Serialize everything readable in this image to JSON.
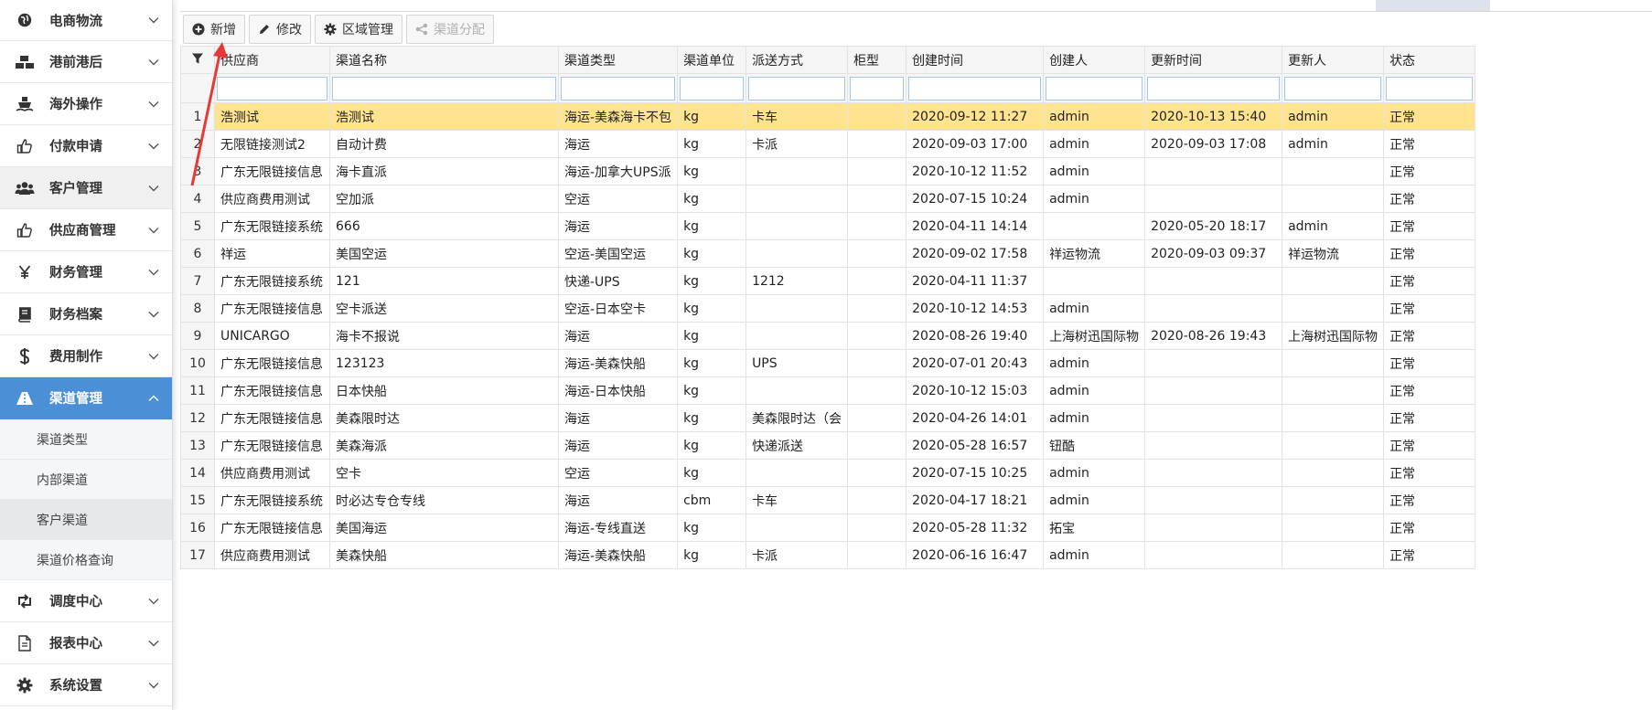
{
  "sidebar": {
    "items": [
      {
        "label": "电商物流",
        "icon": "globe-icon"
      },
      {
        "label": "港前港后",
        "icon": "cubes-icon"
      },
      {
        "label": "海外操作",
        "icon": "ship-icon"
      },
      {
        "label": "付款申请",
        "icon": "thumbs-up-icon"
      },
      {
        "label": "客户管理",
        "icon": "users-icon"
      },
      {
        "label": "供应商管理",
        "icon": "thumbs-up-icon"
      },
      {
        "label": "财务管理",
        "icon": "yen-icon"
      },
      {
        "label": "财务档案",
        "icon": "book-icon"
      },
      {
        "label": "费用制作",
        "icon": "dollar-icon"
      },
      {
        "label": "渠道管理",
        "icon": "road-icon"
      },
      {
        "label": "调度中心",
        "icon": "retweet-icon"
      },
      {
        "label": "报表中心",
        "icon": "file-icon"
      },
      {
        "label": "系统设置",
        "icon": "gear-icon"
      }
    ],
    "submenu": [
      "渠道类型",
      "内部渠道",
      "客户渠道",
      "渠道价格查询"
    ]
  },
  "toolbar": {
    "add_label": "新增",
    "edit_label": "修改",
    "region_label": "区域管理",
    "assign_label": "渠道分配"
  },
  "table": {
    "columns": [
      "供应商",
      "渠道名称",
      "渠道类型",
      "渠道单位",
      "派送方式",
      "柜型",
      "创建时间",
      "创建人",
      "更新时间",
      "更新人",
      "状态"
    ],
    "rows": [
      [
        "1",
        "浩测试",
        "浩测试",
        "海运-美森海卡不包",
        "kg",
        "卡车",
        "",
        "2020-09-12 11:27",
        "admin",
        "2020-10-13 15:40",
        "admin",
        "正常"
      ],
      [
        "2",
        "无限链接测试2",
        "自动计费",
        "海运",
        "kg",
        "卡派",
        "",
        "2020-09-03 17:00",
        "admin",
        "2020-09-03 17:08",
        "admin",
        "正常"
      ],
      [
        "3",
        "广东无限链接信息",
        "海卡直派",
        "海运-加拿大UPS派",
        "kg",
        "",
        "",
        "2020-10-12 11:52",
        "admin",
        "",
        "",
        "正常"
      ],
      [
        "4",
        "供应商费用测试",
        "空加派",
        "空运",
        "kg",
        "",
        "",
        "2020-07-15 10:24",
        "admin",
        "",
        "",
        "正常"
      ],
      [
        "5",
        "广东无限链接系统",
        "666",
        "海运",
        "kg",
        "",
        "",
        "2020-04-11 14:14",
        "",
        "2020-05-20 18:17",
        "admin",
        "正常"
      ],
      [
        "6",
        "祥运",
        "美国空运",
        "空运-美国空运",
        "kg",
        "",
        "",
        "2020-09-02 17:58",
        "祥运物流",
        "2020-09-03 09:37",
        "祥运物流",
        "正常"
      ],
      [
        "7",
        "广东无限链接系统",
        "121",
        "快递-UPS",
        "kg",
        "1212",
        "",
        "2020-04-11 11:37",
        "",
        "",
        "",
        "正常"
      ],
      [
        "8",
        "广东无限链接信息",
        "空卡派送",
        "空运-日本空卡",
        "kg",
        "",
        "",
        "2020-10-12 14:53",
        "admin",
        "",
        "",
        "正常"
      ],
      [
        "9",
        "UNICARGO",
        "海卡不报说",
        "海运",
        "kg",
        "",
        "",
        "2020-08-26 19:40",
        "上海树迅国际物",
        "2020-08-26 19:43",
        "上海树迅国际物",
        "正常"
      ],
      [
        "10",
        "广东无限链接信息",
        "123123",
        "海运-美森快船",
        "kg",
        "UPS",
        "",
        "2020-07-01 20:43",
        "admin",
        "",
        "",
        "正常"
      ],
      [
        "11",
        "广东无限链接信息",
        "日本快船",
        "海运-日本快船",
        "kg",
        "",
        "",
        "2020-10-12 15:03",
        "admin",
        "",
        "",
        "正常"
      ],
      [
        "12",
        "广东无限链接信息",
        "美森限时达",
        "海运",
        "kg",
        "美森限时达（会",
        "",
        "2020-04-26 14:01",
        "admin",
        "",
        "",
        "正常"
      ],
      [
        "13",
        "广东无限链接信息",
        "美森海派",
        "海运",
        "kg",
        "快递派送",
        "",
        "2020-05-28 16:57",
        "钮酷",
        "",
        "",
        "正常"
      ],
      [
        "14",
        "供应商费用测试",
        "空卡",
        "空运",
        "kg",
        "",
        "",
        "2020-07-15 10:25",
        "admin",
        "",
        "",
        "正常"
      ],
      [
        "15",
        "广东无限链接系统",
        "时必达专仓专线",
        "海运",
        "cbm",
        "卡车",
        "",
        "2020-04-17 18:21",
        "admin",
        "",
        "",
        "正常"
      ],
      [
        "16",
        "广东无限链接信息",
        "美国海运",
        "海运-专线直送",
        "kg",
        "",
        "",
        "2020-05-28 11:32",
        "拓宝",
        "",
        "",
        "正常"
      ],
      [
        "17",
        "供应商费用测试",
        "美森快船",
        "海运-美森快船",
        "kg",
        "卡派",
        "",
        "2020-06-16 16:47",
        "admin",
        "",
        "",
        "正常"
      ]
    ]
  },
  "colors": {
    "active_menu": "#4b8fd6",
    "selected_row": "#ffe48f",
    "annotation_arrow": "#e53935"
  }
}
